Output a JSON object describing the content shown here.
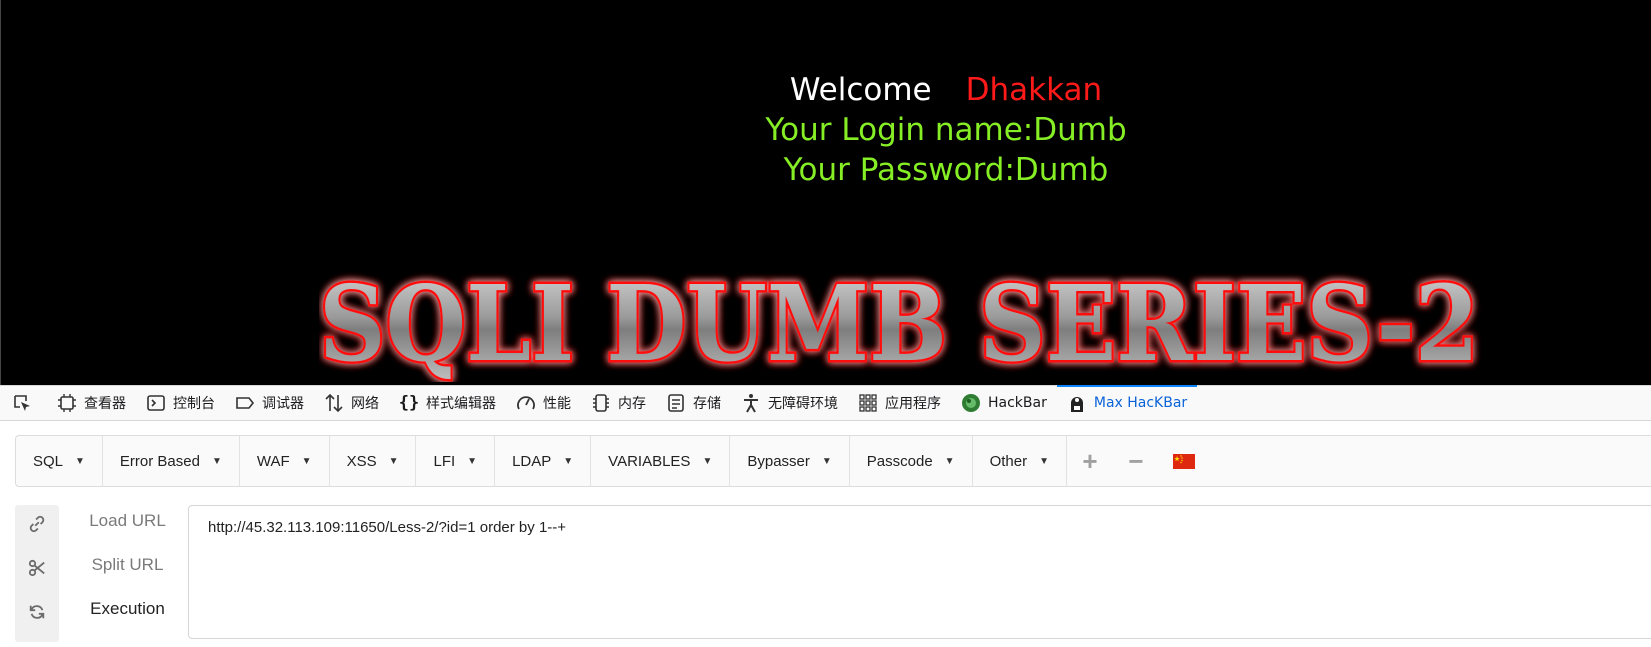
{
  "page": {
    "welcome_word": "Welcome",
    "welcome_name": "Dhakkan",
    "login_line": "Your Login name:Dumb",
    "password_line": "Your Password:Dumb",
    "banner_text": "SQLI DUMB SERIES-2",
    "colors": {
      "background": "#000000",
      "welcome": "#ffffff",
      "name": "#ff1a1a",
      "credentials": "#86ee24",
      "banner_glow": "#ff0000"
    }
  },
  "devtools": {
    "tabs": [
      {
        "label": "",
        "icon": "element-picker-icon"
      },
      {
        "label": "查看器",
        "icon": "inspector-icon"
      },
      {
        "label": "控制台",
        "icon": "console-icon"
      },
      {
        "label": "调试器",
        "icon": "debugger-icon"
      },
      {
        "label": "网络",
        "icon": "network-icon"
      },
      {
        "label": "样式编辑器",
        "icon": "style-editor-icon"
      },
      {
        "label": "性能",
        "icon": "performance-icon"
      },
      {
        "label": "内存",
        "icon": "memory-icon"
      },
      {
        "label": "存储",
        "icon": "storage-icon"
      },
      {
        "label": "无障碍环境",
        "icon": "accessibility-icon"
      },
      {
        "label": "应用程序",
        "icon": "application-icon"
      },
      {
        "label": "HackBar",
        "icon": "hackbar-icon"
      },
      {
        "label": "Max HacKBar",
        "icon": "max-hackbar-icon",
        "active": true
      }
    ],
    "active_color": "#0a84ff"
  },
  "hackbar": {
    "menus": [
      {
        "label": "SQL"
      },
      {
        "label": "Error Based"
      },
      {
        "label": "WAF"
      },
      {
        "label": "XSS"
      },
      {
        "label": "LFI"
      },
      {
        "label": "LDAP"
      },
      {
        "label": "VARIABLES"
      },
      {
        "label": "Bypasser"
      },
      {
        "label": "Passcode"
      },
      {
        "label": "Other"
      }
    ],
    "plus_symbol": "+",
    "minus_symbol": "−",
    "flag_icon": "china-flag-icon",
    "actions": {
      "load_url": "Load URL",
      "split_url": "Split URL",
      "execution": "Execution"
    },
    "side_icons": [
      "link-icon",
      "scissors-icon",
      "refresh-icon"
    ],
    "url_value": "http://45.32.113.109:11650/Less-2/?id=1 order by 1--+"
  }
}
